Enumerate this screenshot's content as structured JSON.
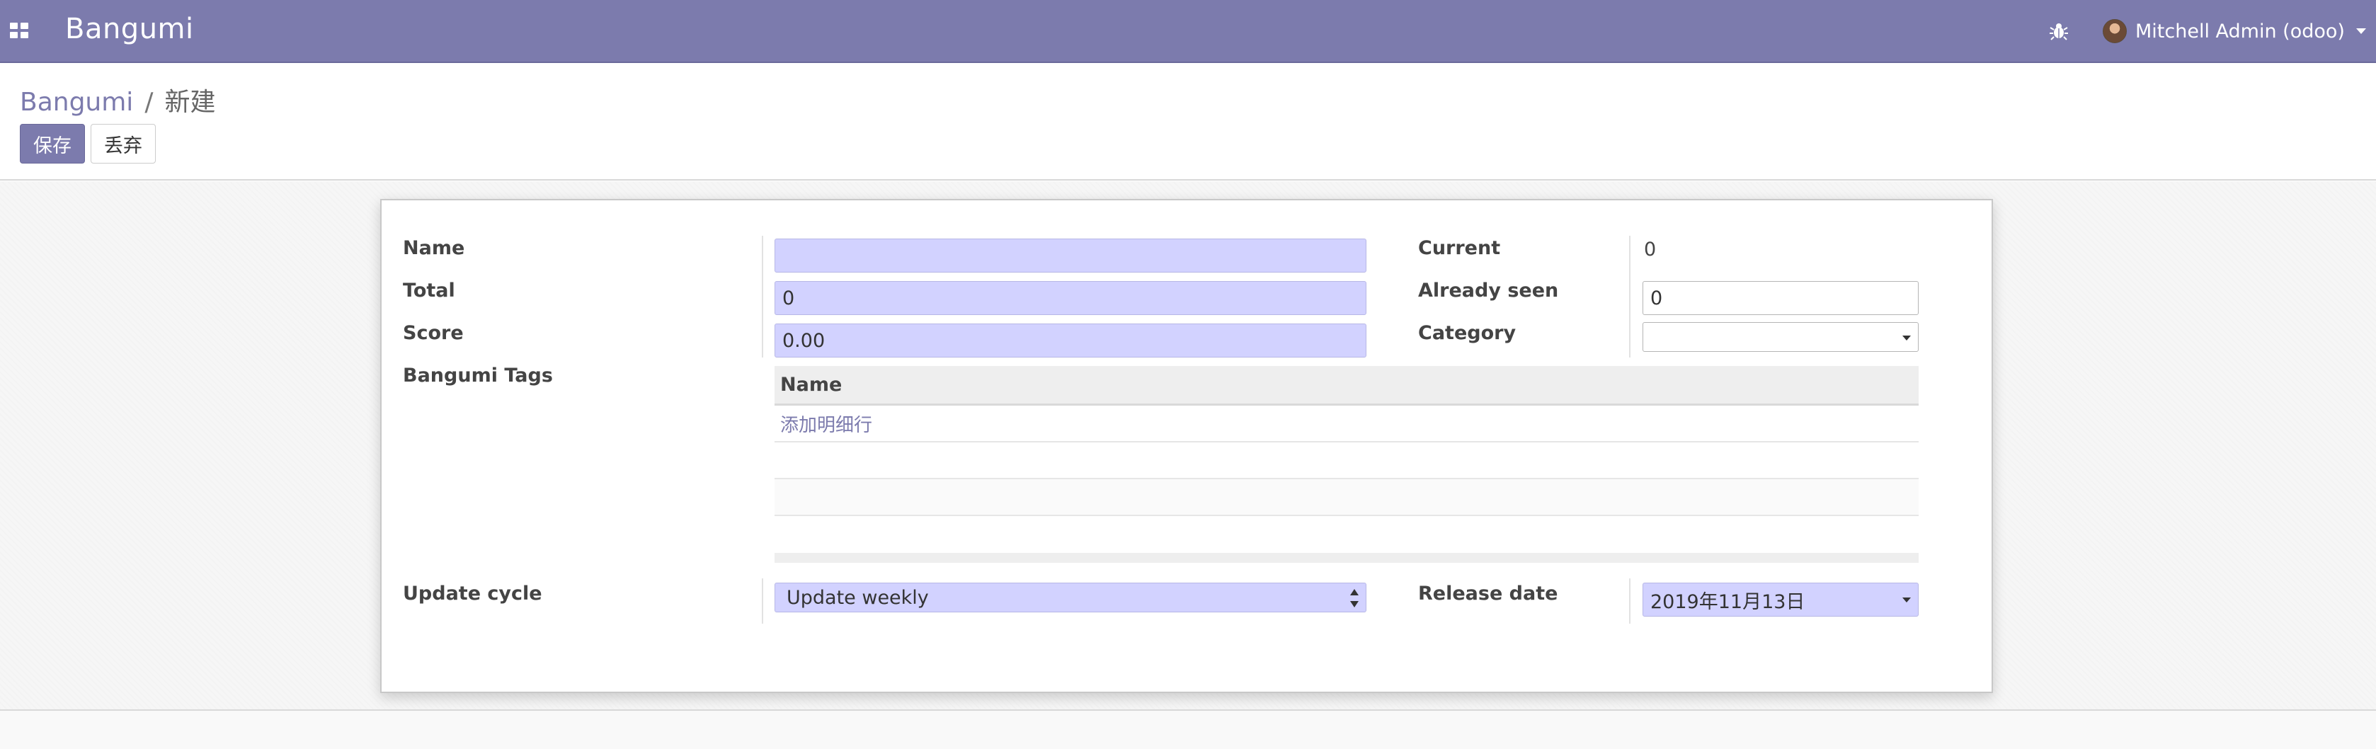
{
  "app": {
    "brand": "Bangumi",
    "user_name": "Mitchell Admin (odoo)"
  },
  "breadcrumb": {
    "parent": "Bangumi",
    "separator": "/",
    "current": "新建"
  },
  "buttons": {
    "save": "保存",
    "discard": "丢弃"
  },
  "form": {
    "name": {
      "label": "Name",
      "value": ""
    },
    "total": {
      "label": "Total",
      "value": "0"
    },
    "score": {
      "label": "Score",
      "value": "0.00"
    },
    "tags": {
      "label": "Bangumi Tags",
      "column_header": "Name",
      "add_line": "添加明细行"
    },
    "current": {
      "label": "Current",
      "value": "0"
    },
    "already_seen": {
      "label": "Already seen",
      "value": "0"
    },
    "category": {
      "label": "Category",
      "value": ""
    },
    "update_cycle": {
      "label": "Update cycle",
      "value": "Update weekly"
    },
    "release_date": {
      "label": "Release date",
      "value": "2019年11月13日"
    }
  },
  "icons": {
    "apps": "apps-grid-icon",
    "debug": "bug-icon",
    "user_caret": "caret-down-icon"
  },
  "colors": {
    "brand": "#7c7bad",
    "required_field": "#d2d2ff"
  }
}
